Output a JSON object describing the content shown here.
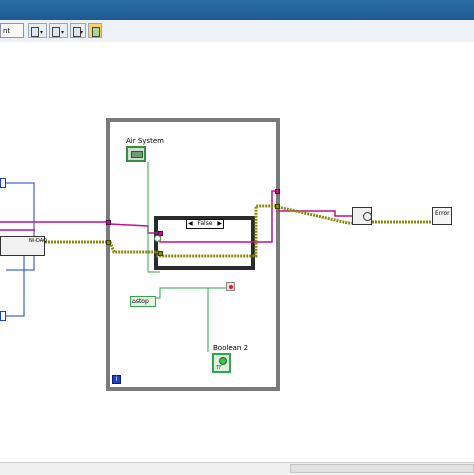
{
  "toolbar": {
    "font_field": "nt",
    "align_icon": "align-objects-icon",
    "distribute_icon": "distribute-objects-icon",
    "reorder_icon": "reorder-icon",
    "cleanup_icon": "clean-up-diagram-icon"
  },
  "diagram": {
    "while_loop_label": "",
    "cluster_indicator": "Air System",
    "case_selector": "False",
    "stop_button": "stop",
    "boolean_indicator": "Boolean 2",
    "loop_iteration": "i",
    "bool_literal": "TF",
    "subvi_left": "NI-DAQ",
    "error_handler_glyph": "Error"
  },
  "colors": {
    "titlebar": "#1e5a91",
    "wire_pink": "#c0128a",
    "wire_olive": "#8a8a10",
    "wire_blue": "#1a3fd6",
    "wire_green": "#2fa64a",
    "loop_border": "#808080"
  }
}
